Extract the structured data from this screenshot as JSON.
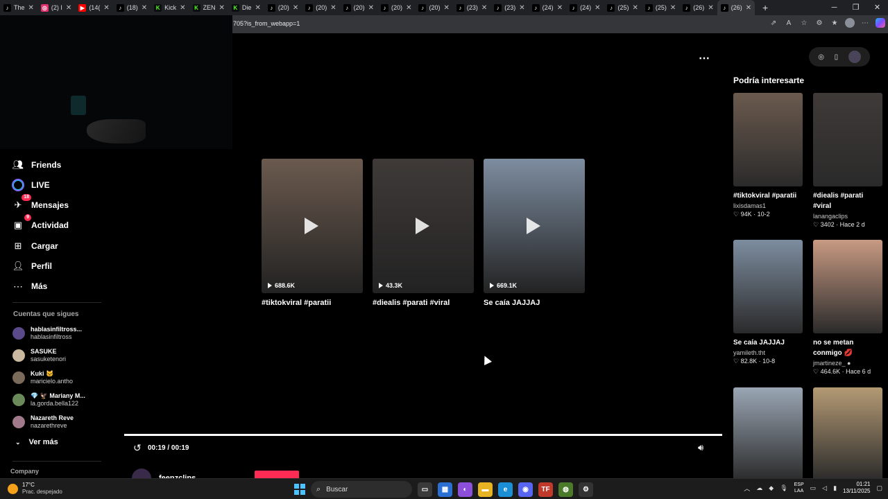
{
  "browser": {
    "tabs": [
      {
        "title": "The",
        "icon": "tiktok-icon",
        "color": "#ffffff"
      },
      {
        "title": "(2) I",
        "icon": "instagram-icon",
        "color": "#e1306c"
      },
      {
        "title": "(14(",
        "icon": "youtube-icon",
        "color": "#ff0000"
      },
      {
        "title": "(18)",
        "icon": "tiktok-icon",
        "color": "#ffffff"
      },
      {
        "title": "Kick",
        "icon": "kick-icon",
        "color": "#53fc18"
      },
      {
        "title": "ZEN",
        "icon": "kick-icon",
        "color": "#53fc18"
      },
      {
        "title": "Die",
        "icon": "kick-icon",
        "color": "#53fc18"
      },
      {
        "title": "(20)",
        "icon": "tiktok-icon",
        "color": "#ffffff"
      },
      {
        "title": "(20)",
        "icon": "tiktok-icon",
        "color": "#ffffff"
      },
      {
        "title": "(20)",
        "icon": "tiktok-icon",
        "color": "#ffffff"
      },
      {
        "title": "(20)",
        "icon": "tiktok-icon",
        "color": "#ffffff"
      },
      {
        "title": "(20)",
        "icon": "tiktok-icon",
        "color": "#ffffff"
      },
      {
        "title": "(23)",
        "icon": "tiktok-icon",
        "color": "#ffffff"
      },
      {
        "title": "(23)",
        "icon": "tiktok-icon",
        "color": "#ffffff"
      },
      {
        "title": "(24)",
        "icon": "tiktok-icon",
        "color": "#ffffff"
      },
      {
        "title": "(24)",
        "icon": "tiktok-icon",
        "color": "#ffffff"
      },
      {
        "title": "(25)",
        "icon": "tiktok-icon",
        "color": "#ffffff"
      },
      {
        "title": "(25)",
        "icon": "tiktok-icon",
        "color": "#ffffff"
      },
      {
        "title": "(26)",
        "icon": "tiktok-icon",
        "color": "#ffffff"
      },
      {
        "title": "(26)",
        "icon": "tiktok-icon",
        "color": "#ffffff",
        "active": true
      }
    ],
    "url": "705?is_from_webapp=1"
  },
  "sidebar": {
    "nav": [
      {
        "label": "Friends",
        "icon": "friends-icon",
        "badge": ""
      },
      {
        "label": "LIVE",
        "icon": "live-icon",
        "badge": ""
      },
      {
        "label": "Mensajes",
        "icon": "messages-icon",
        "badge": "18"
      },
      {
        "label": "Actividad",
        "icon": "activity-icon",
        "badge": "9"
      },
      {
        "label": "Cargar",
        "icon": "upload-icon",
        "badge": ""
      },
      {
        "label": "Perfil",
        "icon": "profile-icon",
        "badge": ""
      },
      {
        "label": "Más",
        "icon": "more-icon",
        "badge": ""
      }
    ],
    "following_title": "Cuentas que sigues",
    "following": [
      {
        "name": "hablasinfiltross...",
        "handle": "hablasinfiltross",
        "color": "#5a4a8a"
      },
      {
        "name": "SASUKE",
        "handle": "sasuketenori",
        "color": "#c9b9a0"
      },
      {
        "name": "Kuki 🐱",
        "handle": "maricielo.antho",
        "color": "#7a6a5a"
      },
      {
        "name": "💎 🦅 Mariany M...",
        "handle": "la.gorda.bella122",
        "color": "#6a8a5a"
      },
      {
        "name": "Nazareth Reve",
        "handle": "nazarethreve",
        "color": "#a07a8a"
      }
    ],
    "see_more": "Ver más",
    "company": "Company"
  },
  "player": {
    "related": [
      {
        "views": "688.6K",
        "caption": "#tiktokviral #paratii",
        "bg": "#6b5a4e"
      },
      {
        "views": "43.3K",
        "caption": "#diealis #parati #viral",
        "bg": "#3f3a38"
      },
      {
        "views": "669.1K",
        "caption": "Se caía JAJJAJ",
        "bg": "#7d8da0"
      }
    ],
    "time": "00:19 / 00:19",
    "progress": 1.0,
    "author": "feenzclips"
  },
  "rail": {
    "title": "Podría interesarte",
    "cards": [
      {
        "caption": "#tiktokviral #paratii",
        "user": "lixisdamas1",
        "meta": "♡ 94K · 10-2",
        "bg": "#6b5a4e"
      },
      {
        "caption": "#diealis #parati #viral",
        "user": "lanangaclips",
        "meta": "♡ 3402 · Hace 2 d",
        "bg": "#3f3a38"
      },
      {
        "caption": "Se caía JAJJAJ",
        "user": "yamileth.tht",
        "meta": "♡ 82.8K · 10-8",
        "bg": "#7d8da0"
      },
      {
        "caption": "no se metan conmigo 💋",
        "user": "jmartineze_ ●",
        "meta": "♡ 464.6K · Hace 6 d",
        "bg": "#c89a82"
      },
      {
        "caption": "",
        "user": "",
        "meta": "",
        "bg": "#9aa6b4"
      },
      {
        "caption": "",
        "user": "",
        "meta": "",
        "bg": "#b49a74"
      }
    ]
  },
  "taskbar": {
    "temp": "17°C",
    "weather": "Prac. despejado",
    "search": "Buscar",
    "lang1": "ESP",
    "lang2": "LAA",
    "time": "01:21",
    "date": "13/11/2025"
  }
}
